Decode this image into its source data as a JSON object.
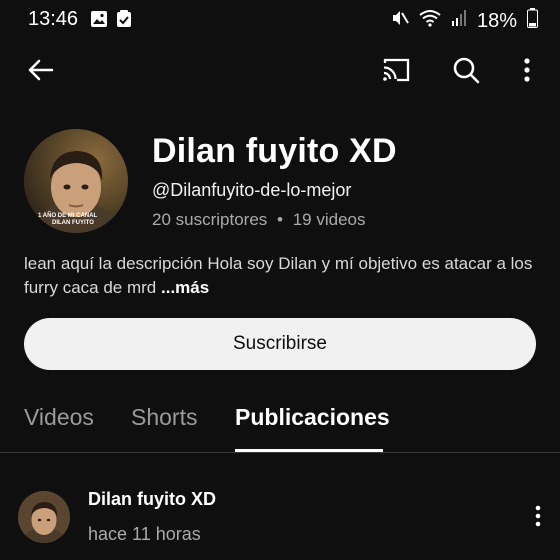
{
  "status": {
    "time": "13:46",
    "battery": "18%"
  },
  "toolbar": {
    "back_icon": "arrow-left-icon",
    "cast_icon": "cast-icon",
    "search_icon": "search-icon",
    "more_icon": "more-vertical-icon"
  },
  "channel": {
    "name": "Dilan fuyito XD",
    "handle": "@Dilanfuyito-de-lo-mejor",
    "subscribers": "20 suscriptores",
    "separator": "•",
    "videos": "19 videos",
    "description": "lean aquí la descripción Hola soy Dilan y mí objetivo es atacar a los furry caca de mrd",
    "more_label": "...más",
    "avatar_caption_1": "1 AÑO DE MI CANAL",
    "avatar_caption_2": "DILAN FUYITO"
  },
  "subscribe_label": "Suscribirse",
  "tabs": [
    {
      "label": "Videos",
      "active": false
    },
    {
      "label": "Shorts",
      "active": false
    },
    {
      "label": "Publicaciones",
      "active": true
    }
  ],
  "post": {
    "author": "Dilan fuyito XD",
    "time": "hace 11 horas"
  }
}
